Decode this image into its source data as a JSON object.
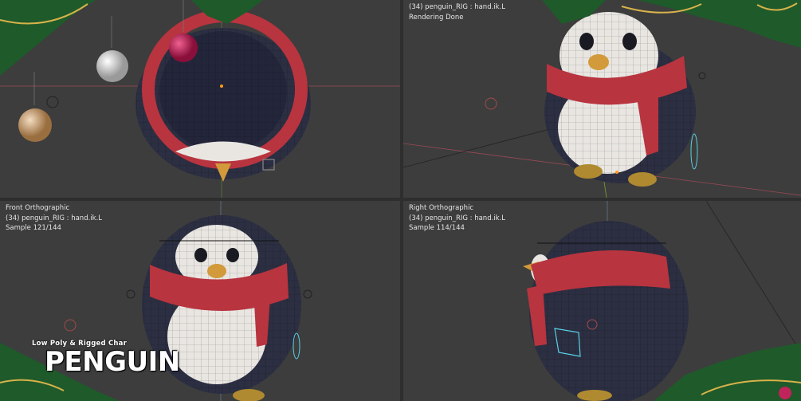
{
  "viewports": {
    "top": {
      "label": "",
      "object": "",
      "status": ""
    },
    "perspective": {
      "label": "",
      "object": "(34) penguin_RIG : hand.ik.L",
      "status": "Rendering Done"
    },
    "front": {
      "label": "Front Orthographic",
      "object": "(34) penguin_RIG : hand.ik.L",
      "status": "Sample 121/144"
    },
    "right": {
      "label": "Right Orthographic",
      "object": "(34) penguin_RIG : hand.ik.L",
      "status": "Sample 114/144"
    }
  },
  "branding": {
    "subtitle": "Low Poly & Rigged Char",
    "title": "PENGUIN"
  },
  "colors": {
    "viewport_bg": "#3d3d3d",
    "separator": "#2e2e2e",
    "scarf": "#b8343f",
    "body": "#2c2f42",
    "belly": "#e9e6e2",
    "beak": "#d29a3a",
    "pine": "#1f5a2a",
    "gold": "#d8b24a",
    "ornament_red": "#c0245a",
    "ornament_silver": "#d8d8d8",
    "ornament_gold": "#caa06a"
  }
}
